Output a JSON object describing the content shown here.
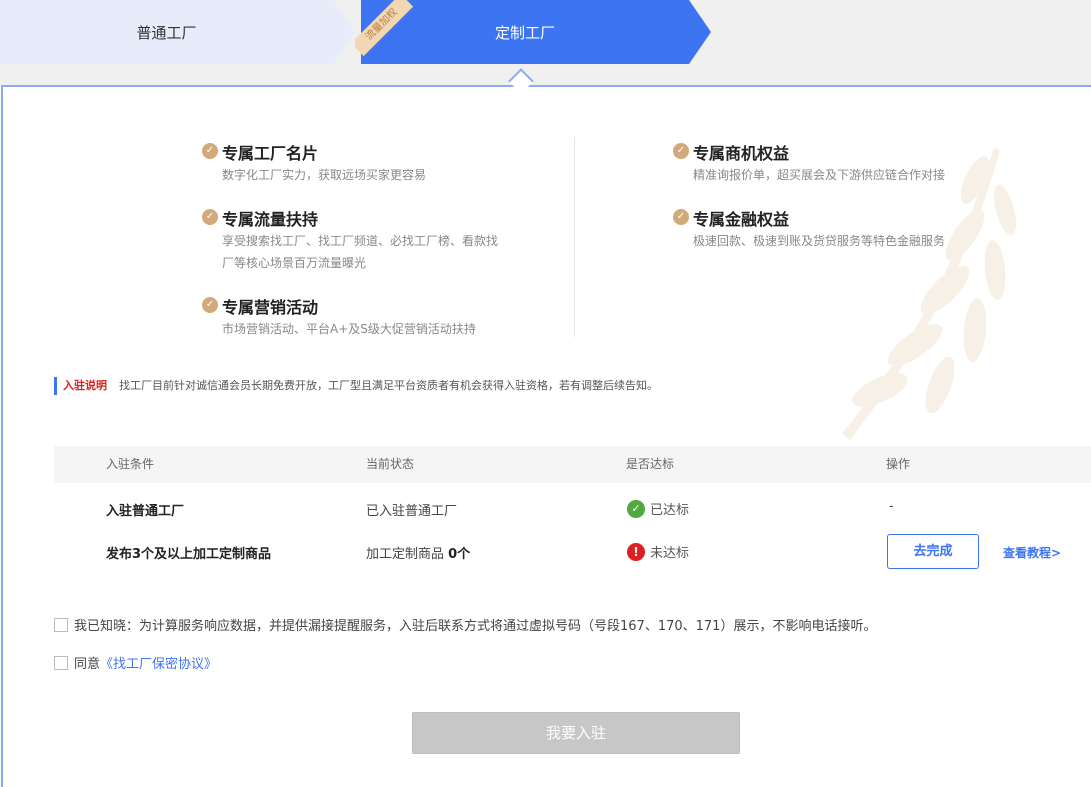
{
  "tabs": {
    "normal_label": "普通工厂",
    "custom_label": "定制工厂",
    "ribbon_text": "流量加权"
  },
  "benefits": [
    {
      "title": "专属工厂名片",
      "desc": "数字化工厂实力，获取远场买家更容易"
    },
    {
      "title": "专属流量扶持",
      "desc_line1": "享受搜索找工厂、找工厂频道、必找工厂榜、看款找",
      "desc_line2": "厂等核心场景百万流量曝光"
    },
    {
      "title": "专属营销活动",
      "desc": "市场营销活动、平台A+及S级大促营销活动扶持"
    },
    {
      "title": "专属商机权益",
      "desc": "精准询报价单，超买展会及下游供应链合作对接"
    },
    {
      "title": "专属金融权益",
      "desc": "极速回款、极速到账及货贷服务等特色金融服务"
    }
  ],
  "notice": {
    "label": "入驻说明",
    "text": "找工厂目前针对诚信通会员长期免费开放，工厂型且满足平台资质者有机会获得入驻资格，若有调整后续告知。"
  },
  "table": {
    "headers": [
      "入驻条件",
      "当前状态",
      "是否达标",
      "操作"
    ],
    "rows": [
      {
        "condition": "入驻普通工厂",
        "status": "已入驻普通工厂",
        "result": "已达标",
        "action": "-"
      },
      {
        "condition": "发布3个及以上加工定制商品",
        "status_prefix": "加工定制商品 ",
        "status_count": "0个",
        "result": "未达标",
        "action_button": "去完成",
        "action_link": "查看教程>"
      }
    ]
  },
  "agreements": {
    "acknowledge_text": "我已知晓：为计算服务响应数据，并提供漏接提醒服务，入驻后联系方式将通过虚拟号码（号段167、170、171）展示，不影响电话接听。",
    "agree_prefix": "同意",
    "agree_link": "《找工厂保密协议》"
  },
  "submit": {
    "label": "我要入驻"
  },
  "colors": {
    "primary": "#3d74f1",
    "tab_inactive": "#e6ecfa",
    "gold": "#d2a97b",
    "success": "#52a840",
    "error": "#e02020",
    "disabled": "#c7c7c7"
  }
}
